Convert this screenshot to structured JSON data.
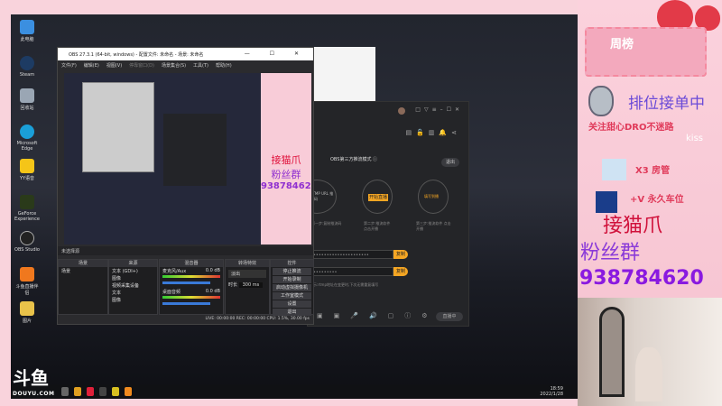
{
  "desktop": {
    "icons": [
      "此电脑",
      "Steam",
      "回收站",
      "Microsoft Edge",
      "YY语音",
      "GeForce Experience",
      "OBS Studio",
      "斗鱼直播伴侣",
      "图片"
    ]
  },
  "douyu": {
    "logo": "斗鱼",
    "domain": "DOUYU.COM"
  },
  "taskbar": {
    "time": "18:59",
    "date": "2022/1/28"
  },
  "obs": {
    "title": "OBS 27.3.1 (64-bit, windows) - 配置文件: 未命名 - 场景: 未命名",
    "window_controls": "— ☐ ✕",
    "menu": [
      "文件(F)",
      "编辑(E)",
      "视图(V)",
      "停靠窗口(D)",
      "场景集合(S)",
      "工具(T)",
      "帮助(H)"
    ],
    "preview_bar": "未选择源",
    "panels": {
      "scenes": "场景",
      "sources": "来源",
      "mixer": "混音器",
      "transitions": "转场特效",
      "controls": "控件"
    },
    "scene_items": [
      "场景"
    ],
    "source_items": [
      "文本 (GDI+)",
      "图像",
      "视频采集设备",
      "文本",
      "图像",
      "图片"
    ],
    "mixer": [
      {
        "name": "麦克风/Aux",
        "db": "0.0 dB"
      },
      {
        "name": "桌面音频",
        "db": "0.0 dB"
      }
    ],
    "transition": {
      "type": "淡出",
      "duration_label": "时长",
      "duration": "300 ms"
    },
    "controls": [
      "停止推流",
      "开始录制",
      "启动虚拟摄像机",
      "工作室模式",
      "设置",
      "退出"
    ],
    "status": "LIVE: 00:00:00  REC: 00:00:00  CPU: 1.5%, 30.00 fps"
  },
  "dark_app": {
    "mode_title": "OBS第三方推流模式 ⓘ",
    "exit": "退出",
    "steps": [
      "RTMP URL 推流码",
      "开始直播",
      "填写到播"
    ],
    "step_desc": [
      "第一步:复制推流码",
      "第二步:推流软件 点击开播",
      "第三步:推流软件 点击开播"
    ],
    "copy": "复制",
    "hint": "提示:rtmp地址在变更时,下次无需重复填写",
    "live_btn": "直播中"
  },
  "sidebar": {
    "weekly": "周榜",
    "rank": "排位接单中",
    "follow": "关注甜心DRO不迷路",
    "admin": "X3 房管",
    "vip": "+V 永久车位",
    "cat": "接猫爪",
    "fans": "粉丝群",
    "group": "938784620",
    "deco": "kiss"
  }
}
